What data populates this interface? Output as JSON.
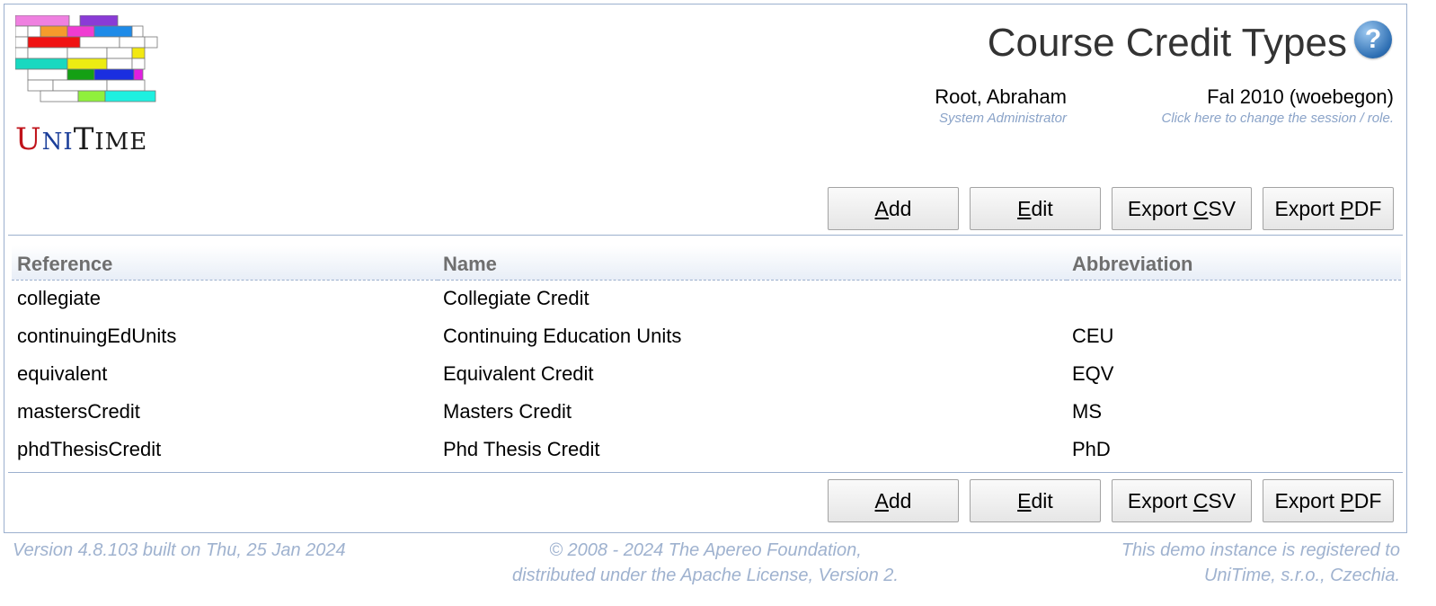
{
  "app": {
    "logo_text": [
      "U",
      "NI",
      "T",
      "IME"
    ]
  },
  "header": {
    "title": "Course Credit Types",
    "help_icon": "help-icon",
    "user": {
      "name": "Root, Abraham",
      "role": "System Administrator"
    },
    "session": {
      "name": "Fal 2010 (woebegon)",
      "hint": "Click here to change the session / role."
    }
  },
  "buttons": {
    "add_prefix": "",
    "add_key": "A",
    "add_rest": "dd",
    "edit_prefix": "",
    "edit_key": "E",
    "edit_rest": "dit",
    "csv_prefix": "Export ",
    "csv_key": "C",
    "csv_rest": "SV",
    "pdf_prefix": "Export ",
    "pdf_key": "P",
    "pdf_rest": "DF"
  },
  "table": {
    "headers": [
      "Reference",
      "Name",
      "Abbreviation"
    ],
    "rows": [
      [
        "collegiate",
        "Collegiate Credit",
        ""
      ],
      [
        "continuingEdUnits",
        "Continuing Education Units",
        "CEU"
      ],
      [
        "equivalent",
        "Equivalent Credit",
        "EQV"
      ],
      [
        "mastersCredit",
        "Masters Credit",
        "MS"
      ],
      [
        "phdThesisCredit",
        "Phd Thesis Credit",
        "PhD"
      ]
    ]
  },
  "footer": {
    "version": "Version 4.8.103 built on Thu, 25 Jan 2024",
    "copyright_line1": "© 2008 - 2024 The Apereo Foundation,",
    "copyright_line2": "distributed under the Apache License, Version 2.",
    "registration_line1": "This demo instance is registered to",
    "registration_line2": "UniTime, s.r.o., Czechia."
  }
}
